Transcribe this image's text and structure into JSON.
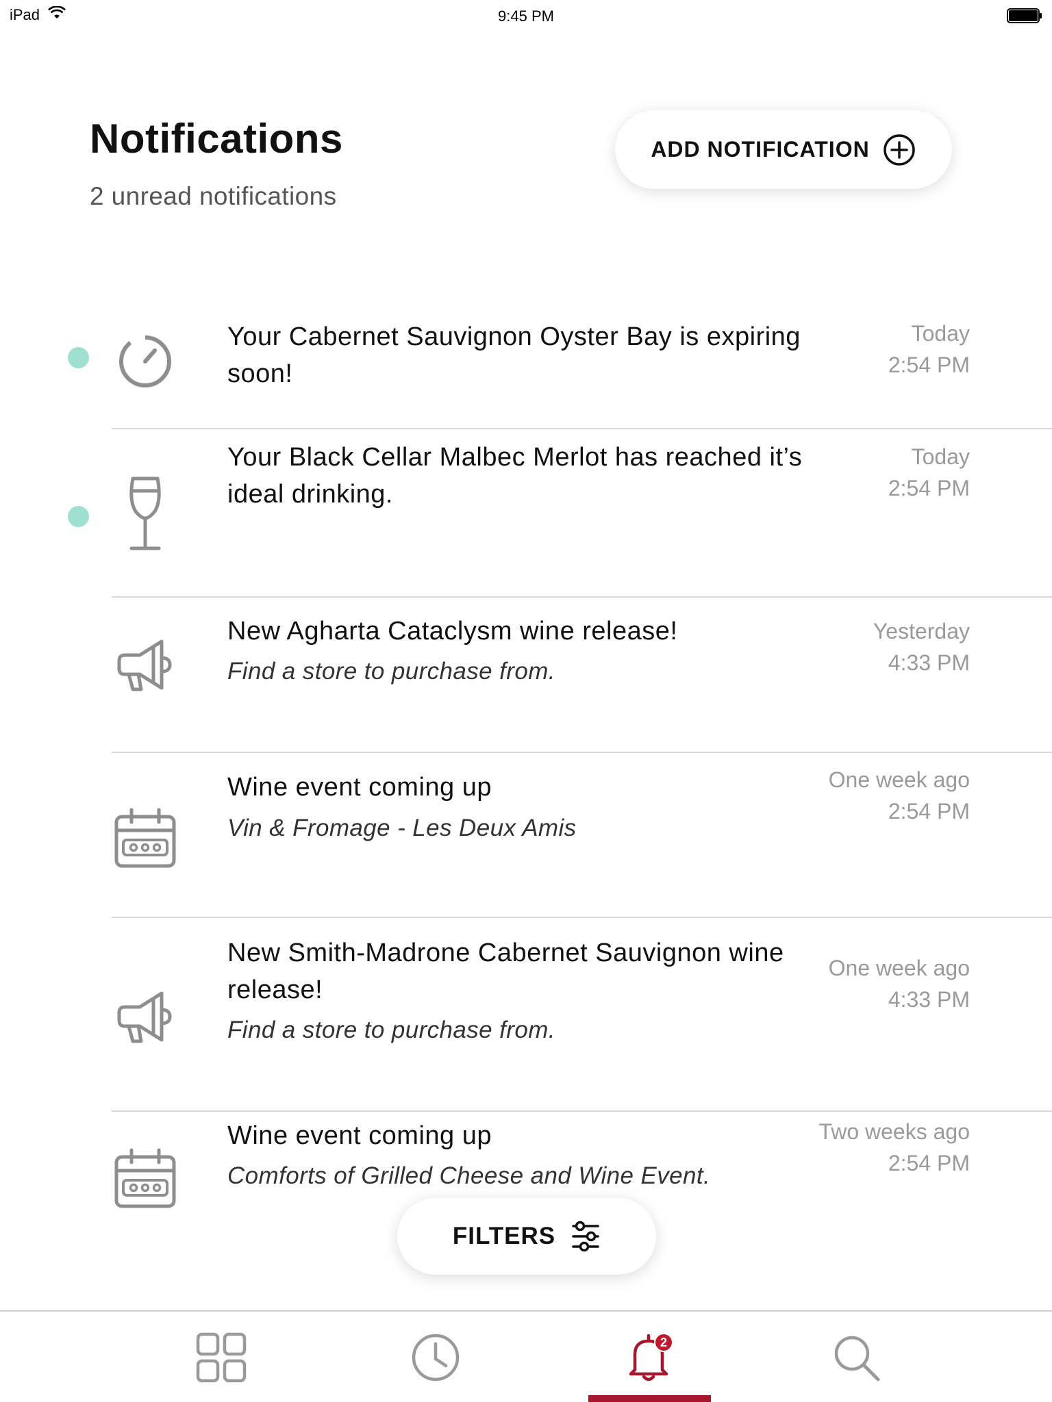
{
  "status_bar": {
    "device": "iPad",
    "time": "9:45 PM"
  },
  "header": {
    "title": "Notifications",
    "subtitle": "2 unread notifications",
    "add_button_label": "ADD NOTIFICATION"
  },
  "notifications": [
    {
      "icon": "timer-icon",
      "unread": true,
      "title": "Your Cabernet Sauvignon Oyster Bay is expiring soon!",
      "subtitle": "",
      "day": "Today",
      "time": "2:54 PM"
    },
    {
      "icon": "wine-glass-icon",
      "unread": true,
      "title": "Your Black Cellar Malbec Merlot has reached it’s ideal drinking.",
      "subtitle": "",
      "day": "Today",
      "time": "2:54 PM"
    },
    {
      "icon": "megaphone-icon",
      "unread": false,
      "title": "New Agharta Cataclysm wine release!",
      "subtitle": "Find a store to purchase from.",
      "day": "Yesterday",
      "time": "4:33 PM"
    },
    {
      "icon": "calendar-icon",
      "unread": false,
      "title": "Wine event coming up",
      "subtitle": "Vin & Fromage - Les Deux Amis",
      "day": "One week ago",
      "time": "2:54 PM"
    },
    {
      "icon": "megaphone-icon",
      "unread": false,
      "title": "New Smith-Madrone Cabernet Sauvignon wine release!",
      "subtitle": "Find a store to purchase from.",
      "day": "One week ago",
      "time": "4:33 PM"
    },
    {
      "icon": "calendar-icon",
      "unread": false,
      "title": "Wine event coming up",
      "subtitle": "Comforts of Grilled Cheese and Wine Event.",
      "day": "Two weeks ago",
      "time": "2:54 PM"
    }
  ],
  "filters_label": "FILTERS",
  "tab_bar": {
    "tabs": [
      {
        "name": "grid-icon",
        "active": false
      },
      {
        "name": "clock-icon",
        "active": false
      },
      {
        "name": "bell-icon",
        "active": true
      },
      {
        "name": "search-icon",
        "active": false
      }
    ],
    "badge_count": "2"
  },
  "colors": {
    "unread_dot": "#9fe0d0",
    "accent": "#a6172e",
    "badge": "#c0182f",
    "icon_gray": "#8e8e8e"
  }
}
